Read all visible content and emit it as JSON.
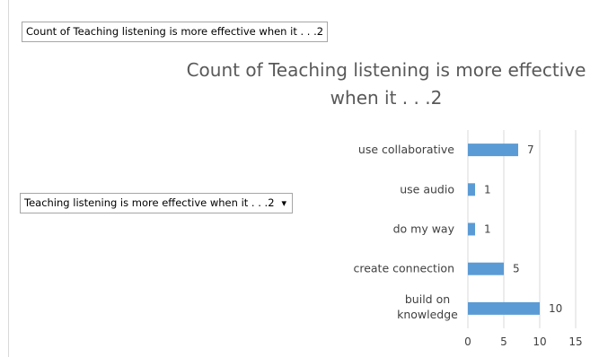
{
  "pivot": {
    "values_field": "Count of Teaching listening is more effective when it . . .2",
    "axis_field": "Teaching listening is more effective when it . . .2",
    "dropdown_glyph": "▾"
  },
  "chart_data": {
    "type": "bar",
    "orientation": "horizontal",
    "title": "Count of Teaching listening is more effective when it . . .2",
    "categories": [
      "use collaborative",
      "use audio",
      "do my way",
      "create connection",
      "build on knowledge"
    ],
    "values": [
      7,
      1,
      1,
      5,
      10
    ],
    "xlim": [
      0,
      15
    ],
    "xticks": [
      "0",
      "5",
      "10",
      "15"
    ],
    "xlabel": "",
    "ylabel": "",
    "grid": true,
    "data_labels": true,
    "legend": "none",
    "bar_color": "#5b9bd5",
    "grid_color": "#d9d9d9"
  }
}
